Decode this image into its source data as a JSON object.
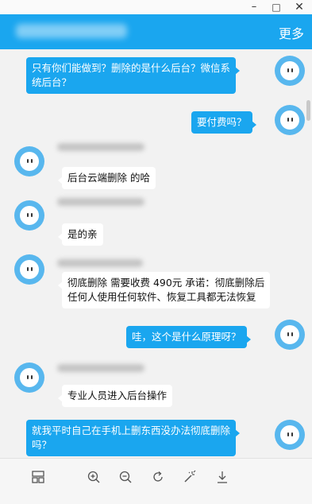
{
  "header": {
    "more_label": "更多"
  },
  "window_controls": {
    "minimize": "–",
    "maximize": "□",
    "close": "✕"
  },
  "messages": [
    {
      "side": "out",
      "lines": [
        "只有你们能做到？删除的是什么后台？微信系",
        "统后台？"
      ]
    },
    {
      "side": "out",
      "lines": [
        "要付费吗？"
      ]
    },
    {
      "side": "in",
      "lines": [
        "后台云端删除 的哈"
      ]
    },
    {
      "side": "in",
      "lines": [
        "是的亲"
      ]
    },
    {
      "side": "in",
      "lines": [
        "彻底删除 需要收费 490元 承诺：彻底删除后",
        "任何人使用任何软件、恢复工具都无法恢复"
      ]
    },
    {
      "side": "out",
      "lines": [
        "哇，这个是什么原理呀？"
      ]
    },
    {
      "side": "in",
      "lines": [
        "专业人员进入后台操作"
      ]
    },
    {
      "side": "out",
      "lines": [
        "就我平时自己在手机上删东西没办法彻底删除",
        "吗？"
      ]
    }
  ],
  "toolbar": {
    "layout_icon": "layout-icon",
    "zoom_in_icon": "zoom-in-icon",
    "zoom_out_icon": "zoom-out-icon",
    "rotate_icon": "rotate-icon",
    "magic_icon": "magic-wand-icon",
    "download_icon": "download-icon"
  },
  "colors": {
    "accent": "#1aa6ef",
    "background": "#f2f2f2",
    "avatar": "#58b7ee"
  }
}
